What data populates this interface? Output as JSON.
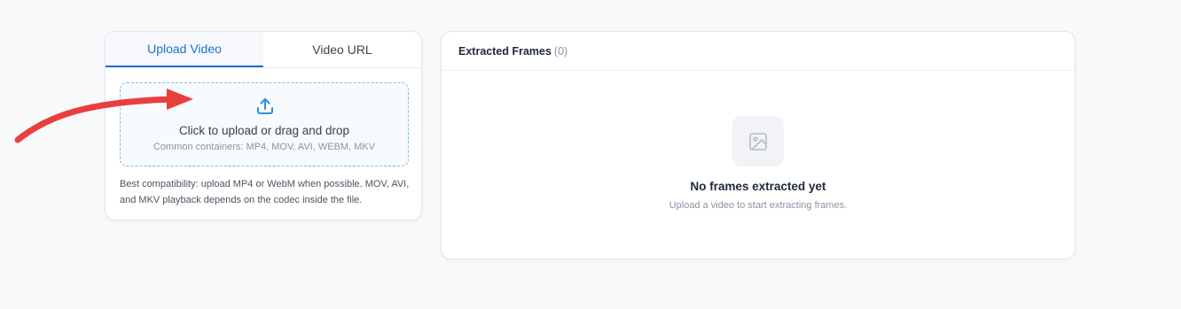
{
  "upload_panel": {
    "tabs": [
      {
        "label": "Upload Video",
        "active": true
      },
      {
        "label": "Video URL",
        "active": false
      }
    ],
    "dropzone": {
      "icon": "upload-icon",
      "title": "Click to upload or drag and drop",
      "subtitle": "Common containers: MP4, MOV, AVI, WEBM, MKV"
    },
    "note": "Best compatibility: upload MP4 or WebM when possible. MOV, AVI, and MKV playback depends on the codec inside the file."
  },
  "frames_panel": {
    "title": "Extracted Frames",
    "count": "(0)",
    "empty_state": {
      "icon": "image-icon",
      "title": "No frames extracted yet",
      "subtitle": "Upload a video to start extracting frames."
    }
  },
  "colors": {
    "accent": "#1d6fd6",
    "dropzone_border": "#7bbbe8",
    "annotation": "#e8403f",
    "background": "#f8f9fb"
  }
}
